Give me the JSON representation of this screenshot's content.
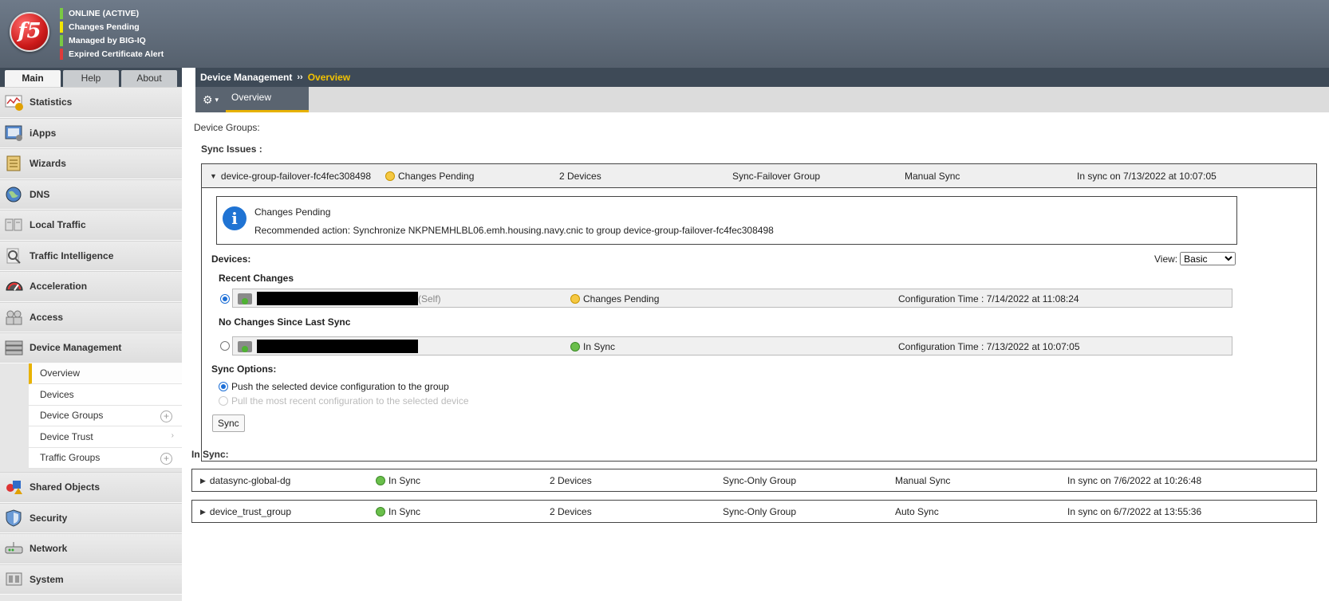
{
  "header": {
    "logo_text": "f5",
    "status": [
      {
        "label": "ONLINE (ACTIVE)",
        "color": "#7ac943"
      },
      {
        "label": "Changes Pending",
        "color": "#f2e600"
      },
      {
        "label": "Managed by BIG-IQ",
        "color": "#7ac943"
      },
      {
        "label": "Expired Certificate Alert",
        "color": "#e03a3a"
      }
    ]
  },
  "nav_tabs": [
    "Main",
    "Help",
    "About"
  ],
  "nav_items_top": [
    "Statistics",
    "iApps",
    "Wizards",
    "DNS",
    "Local Traffic",
    "Traffic Intelligence",
    "Acceleration",
    "Access",
    "Device Management"
  ],
  "device_mgmt_sub": [
    "Overview",
    "Devices",
    "Device Groups",
    "Device Trust",
    "Traffic Groups"
  ],
  "nav_items_bottom": [
    "Shared Objects",
    "Security",
    "Network",
    "System"
  ],
  "breadcrumb": {
    "parent": "Device Management",
    "sep": "››",
    "current": "Overview"
  },
  "subtab": "Overview",
  "content": {
    "device_groups_label": "Device Groups:",
    "sync_issues_label": "Sync Issues :",
    "failover_group": {
      "name": "device-group-failover-fc4fec308498",
      "status": "Changes Pending",
      "devices": "2 Devices",
      "type": "Sync-Failover Group",
      "sync_mode": "Manual Sync",
      "sync_time": "In sync on 7/13/2022 at 10:07:05"
    },
    "info": {
      "title": "Changes Pending",
      "action": "Recommended action: Synchronize NKPNEMHLBL06.emh.housing.navy.cnic to group device-group-failover-fc4fec308498"
    },
    "devices_label": "Devices:",
    "view_label": "View:",
    "view_value": "Basic",
    "recent_changes_label": "Recent Changes",
    "device1": {
      "self": "(Self)",
      "status": "Changes Pending",
      "config_time": "Configuration Time : 7/14/2022 at 11:08:24"
    },
    "no_changes_label": "No Changes Since Last Sync",
    "device2": {
      "status": "In Sync",
      "config_time": "Configuration Time : 7/13/2022 at 10:07:05"
    },
    "sync_options_label": "Sync Options:",
    "option_push": "Push the selected device configuration to the group",
    "option_pull": "Pull the most recent configuration to the selected device",
    "sync_button": "Sync",
    "in_sync_label": "In Sync:",
    "groups": [
      {
        "name": "datasync-global-dg",
        "status": "In Sync",
        "devices": "2 Devices",
        "type": "Sync-Only Group",
        "sync_mode": "Manual Sync",
        "sync_time": "In sync on 7/6/2022 at 10:26:48"
      },
      {
        "name": "device_trust_group",
        "status": "In Sync",
        "devices": "2 Devices",
        "type": "Sync-Only Group",
        "sync_mode": "Auto Sync",
        "sync_time": "In sync on 6/7/2022 at 13:55:36"
      }
    ]
  }
}
